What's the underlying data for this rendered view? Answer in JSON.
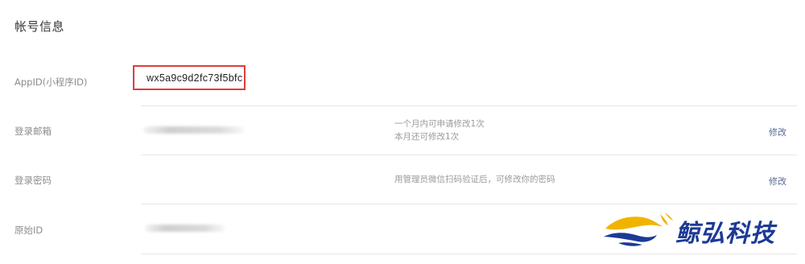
{
  "section": {
    "title": "帐号信息"
  },
  "rows": {
    "appid": {
      "label": "AppID(小程序ID)",
      "value": "wx5a9c9d2fc73f5bfc"
    },
    "email": {
      "label": "登录邮箱",
      "note_1": "一个月内可申请修改1次",
      "note_2": "本月还可修改1次",
      "action": "修改"
    },
    "password": {
      "label": "登录密码",
      "note": "用管理员微信扫码验证后，可修改你的密码",
      "action": "修改"
    },
    "original_id": {
      "label": "原始ID"
    }
  },
  "watermark": {
    "text": "鲸弘科技",
    "color": "#1c3a96",
    "accent": "#f0b400"
  },
  "colors": {
    "highlight_border": "#e03c3c",
    "link": "#576b95"
  }
}
